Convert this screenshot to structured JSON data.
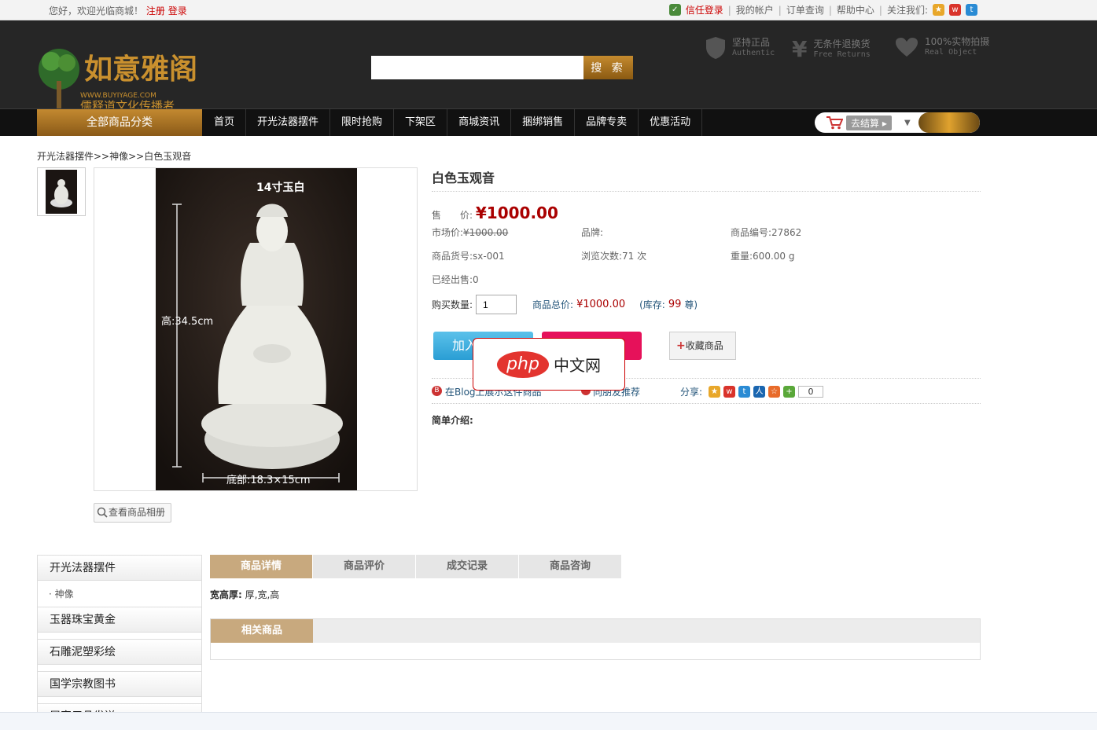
{
  "topbar": {
    "greeting": "您好，欢迎光临商城！",
    "register": "注册",
    "login": "登录",
    "trust_login": "信任登录",
    "links": [
      "我的帐户",
      "订单查询",
      "帮助中心"
    ],
    "follow": "关注我们:"
  },
  "header": {
    "search_button": "搜 索",
    "search_value": "",
    "promos": [
      {
        "title": "坚持正品",
        "sub": "Authentic"
      },
      {
        "title": "无条件退换货",
        "sub": "Free Returns"
      },
      {
        "title": "100%实物拍摄",
        "sub": "Real Object"
      }
    ]
  },
  "nav": {
    "all_categories": "全部商品分类",
    "items": [
      "首页",
      "开光法器摆件",
      "限时抢购",
      "下架区",
      "商城资讯",
      "捆绑销售",
      "品牌专卖",
      "优惠活动"
    ],
    "cart_checkout": "去结算"
  },
  "breadcrumb": "开光法器摆件>>神像>>白色玉观音",
  "product": {
    "image_caption_top": "14寸玉白",
    "image_caption_height": "高:34.5cm",
    "image_caption_base": "底部:18.3×15cm",
    "album_button": "查看商品相册",
    "name": "白色玉观音",
    "price_label": "售　　价:",
    "price": "¥1000.00",
    "market_price_label": "市场价:",
    "market_price": "¥1000.00",
    "brand_label": "品牌:",
    "brand": "",
    "sku_label": "商品编号:",
    "sku": "27862",
    "item_no_label": "商品货号:",
    "item_no": "sx-001",
    "views_label": "浏览次数:",
    "views": "71 次",
    "weight_label": "重量:",
    "weight": "600.00 g",
    "sold_label": "已经出售:",
    "sold": "0",
    "qty_label": "购买数量:",
    "qty": "1",
    "total_label": "商品总价:",
    "total": "¥1000.00",
    "stock_prefix": "(库存:",
    "stock": "99",
    "stock_suffix": "尊)",
    "add_cart": "加入",
    "favorite": "收藏商品",
    "blog_link": "在Blog上展示这件商品",
    "recommend_link": "向朋友推荐",
    "share_label": "分享:",
    "share_count": "0",
    "intro_label": "简单介绍:"
  },
  "overlay": {
    "php": "php",
    "text": "中文网"
  },
  "sidebar": {
    "cat1": "开光法器摆件",
    "sub1": "神像",
    "cat2": "玉器珠宝黄金",
    "cat3": "石雕泥塑彩绘",
    "cat4": "国学宗教图书",
    "cat5": "居家用品发送"
  },
  "tabs": [
    "商品详情",
    "商品评价",
    "成交记录",
    "商品咨询"
  ],
  "detail": {
    "label": "宽高厚:",
    "value": "厚,宽,高"
  },
  "related": "相关商品",
  "colors": {
    "gold": "#c38930",
    "nav_bg": "#111111",
    "header_bg": "#262626",
    "price_red": "#aa0000",
    "tab_active": "#c8a97e"
  }
}
